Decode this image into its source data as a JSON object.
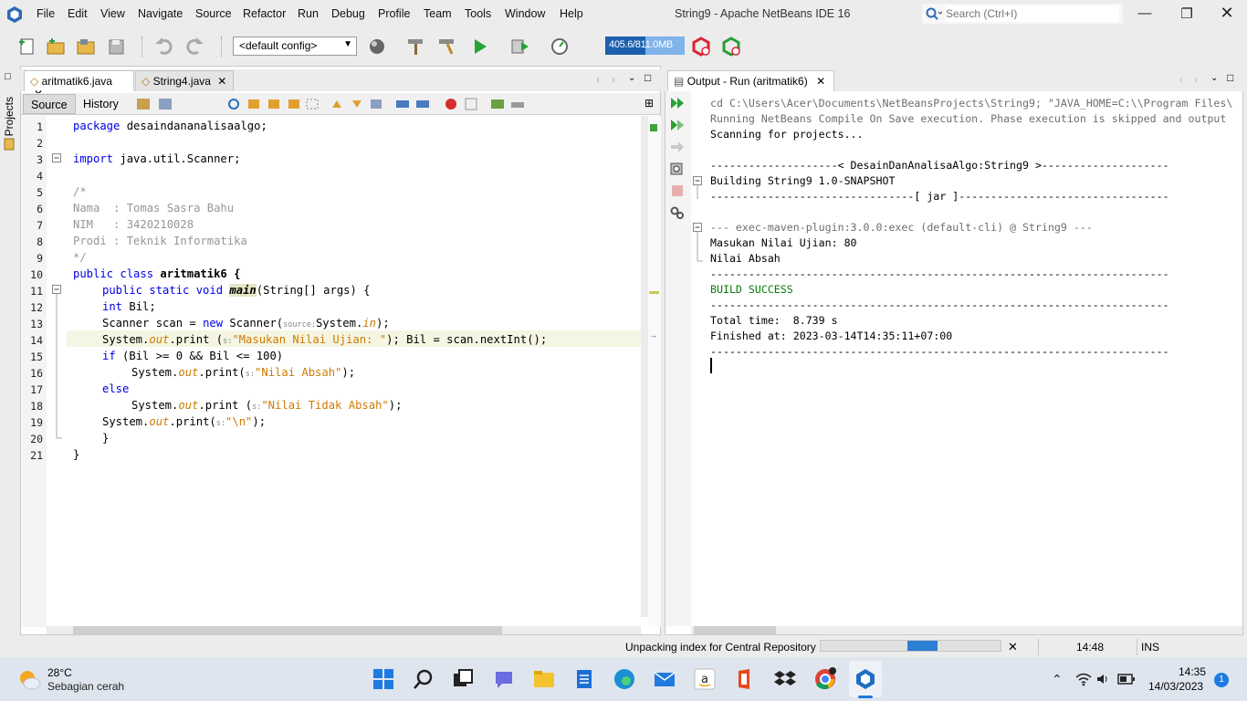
{
  "window": {
    "title": "String9 - Apache NetBeans IDE 16"
  },
  "menu": [
    "File",
    "Edit",
    "View",
    "Navigate",
    "Source",
    "Refactor",
    "Run",
    "Debug",
    "Profile",
    "Team",
    "Tools",
    "Window",
    "Help"
  ],
  "search": {
    "placeholder": "Search (Ctrl+I)"
  },
  "toolbar": {
    "config": "<default config>",
    "memory": "405.6/811.0MB",
    "memory_fraction": 0.5
  },
  "sidebar": {
    "projects_label": "Projects"
  },
  "editor": {
    "tabs": [
      {
        "label": "aritmatik6.java"
      },
      {
        "label": "String4.java"
      }
    ],
    "modes": {
      "source": "Source",
      "history": "History"
    },
    "line_numbers": [
      "1",
      "2",
      "3",
      "4",
      "5",
      "6",
      "7",
      "8",
      "9",
      "10",
      "11",
      "12",
      "13",
      "14",
      "15",
      "16",
      "17",
      "18",
      "19",
      "20",
      "21"
    ]
  },
  "code": {
    "l1_kw": "package",
    "l1_rest": " desaindananalisaalgo;",
    "l3_kw": "import",
    "l3_rest": " java.util.Scanner;",
    "l5": "/*",
    "l6": "Nama  : Tomas Sasra Bahu",
    "l7": "NIM   : 3420210028",
    "l8": "Prodi : Teknik Informatika",
    "l9": "*/",
    "l10_kw": "public class",
    "l10_rest": " aritmatik6 {",
    "l11_kw": "public static void",
    "l11_main": "main",
    "l11_rest": "(String[] args) {",
    "l12_kw": "int",
    "l12_rest": " Bil;",
    "l13_a": "Scanner scan = ",
    "l13_new": "new",
    "l13_b": " Scanner(",
    "l13_hint": "source:",
    "l13_c": "System.",
    "l13_in": "in",
    "l13_d": ");",
    "sys": "System.",
    "out": "out",
    "l14_a": ".print (",
    "hint_s": "s:",
    "l14_str": "\"Masukan Nilai Ujian: \"",
    "l14_b": "); Bil = scan.nextInt();",
    "l15_kw": "if",
    "l15_rest": " (Bil >= 0 && Bil <= 100)",
    "l16_a": ".print(",
    "l16_str": "\"Nilai Absah\"",
    "l16_b": ");",
    "l17_kw": "else",
    "l18_a": ".print (",
    "l18_str": "\"Nilai Tidak Absah\"",
    "l18_b": ");",
    "l19_a": ".print(",
    "l19_str": "\"\\n\"",
    "l19_b": ");",
    "l20": "}",
    "l21": "}"
  },
  "output": {
    "tab": "Output - Run (aritmatik6)",
    "lines": [
      "cd C:\\Users\\Acer\\Documents\\NetBeansProjects\\String9; \"JAVA_HOME=C:\\\\Program Files\\",
      "Running NetBeans Compile On Save execution. Phase execution is skipped and output",
      "Scanning for projects...",
      "",
      "--------------------< DesainDanAnalisaAlgo:String9 >--------------------",
      "Building String9 1.0-SNAPSHOT",
      "--------------------------------[ jar ]---------------------------------",
      "",
      "--- exec-maven-plugin:3.0.0:exec (default-cli) @ String9 ---",
      "Masukan Nilai Ujian: 80",
      "Nilai Absah",
      "------------------------------------------------------------------------",
      "BUILD SUCCESS",
      "------------------------------------------------------------------------",
      "Total time:  8.739 s",
      "Finished at: 2023-03-14T14:35:11+07:00",
      "------------------------------------------------------------------------"
    ]
  },
  "status": {
    "task": "Unpacking index for Central Repository",
    "position": "14:48",
    "mode": "INS",
    "progress_fraction": 0.5
  },
  "taskbar": {
    "temp": "28°C",
    "weather": "Sebagian cerah",
    "time": "14:35",
    "date": "14/03/2023",
    "notifications": "1"
  },
  "colors": {
    "accent": "#2c7fd4",
    "keyword": "#0000e6",
    "string": "#ce7b00",
    "comment": "#969696",
    "success": "#0a7a0a"
  }
}
